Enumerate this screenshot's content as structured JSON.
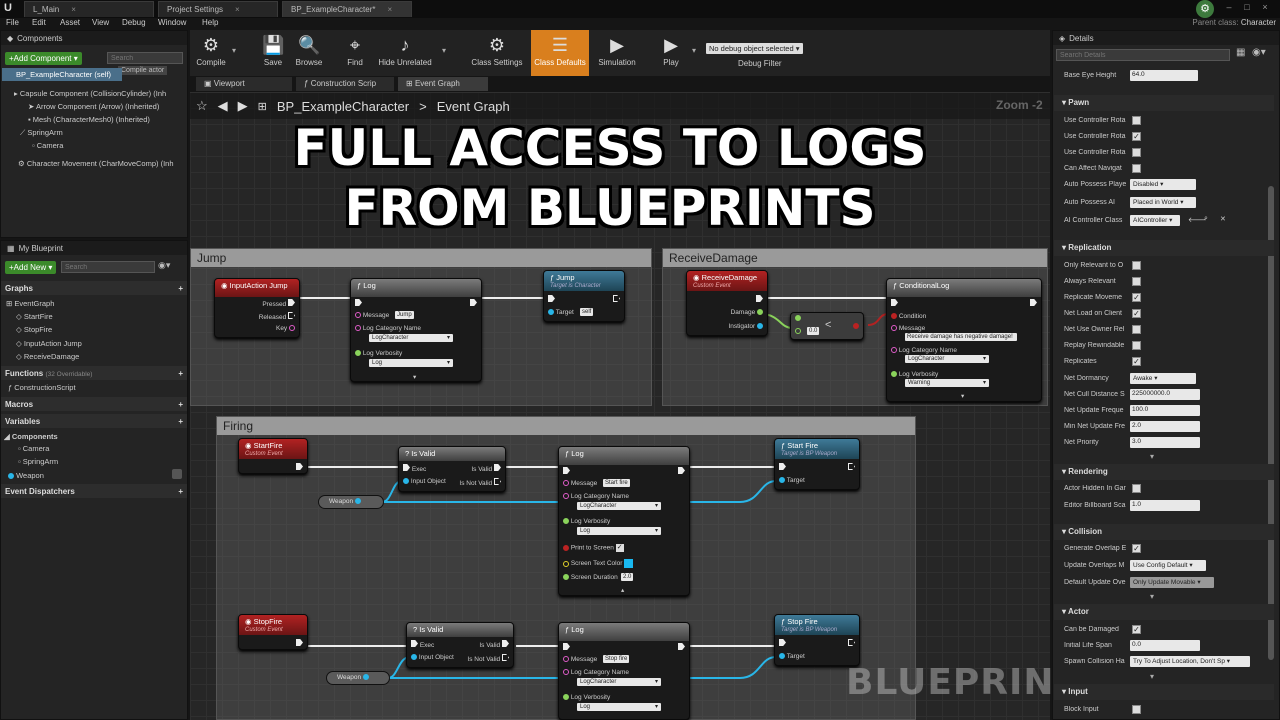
{
  "titlebar": {
    "tabs": [
      "L_Main",
      "Project Settings",
      "BP_ExampleCharacter*"
    ],
    "parent_class_label": "Parent class:",
    "parent_class_value": "Character"
  },
  "menu": [
    "File",
    "Edit",
    "Asset",
    "View",
    "Debug",
    "Window",
    "Help"
  ],
  "components": {
    "title": "Components",
    "add_button": "+Add Component ▾",
    "search_placeholder": "Search",
    "tooltip": "Compile actor",
    "items": [
      "BP_ExampleCharacter (self)",
      "Capsule Component (CollisionCylinder) (Inh",
      "Arrow Component (Arrow) (Inherited)",
      "Mesh (CharacterMesh0) (Inherited)",
      "SpringArm",
      "Camera",
      "Character Movement (CharMoveComp) (Inh"
    ]
  },
  "my_blueprint": {
    "title": "My Blueprint",
    "add_button": "+Add New ▾",
    "search_placeholder": "Search",
    "graphs_label": "Graphs",
    "graph_items": [
      "EventGraph",
      "StartFire",
      "StopFire",
      "InputAction Jump",
      "ReceiveDamage"
    ],
    "functions_label": "Functions",
    "functions_count": "(32 Overridable)",
    "function_items": [
      "ConstructionScript"
    ],
    "macros_label": "Macros",
    "variables_label": "Variables",
    "components_label": "Components",
    "component_vars": [
      "Camera",
      "SpringArm"
    ],
    "weapon_var": "Weapon",
    "dispatchers_label": "Event Dispatchers"
  },
  "toolbar": {
    "compile": "Compile",
    "save": "Save",
    "browse": "Browse",
    "find": "Find",
    "hide_unrelated": "Hide Unrelated",
    "class_settings": "Class Settings",
    "class_defaults": "Class Defaults",
    "simulation": "Simulation",
    "play": "Play",
    "debug_object": "No debug object selected ▾",
    "debug_filter": "Debug Filter"
  },
  "graph_tabs": [
    "Viewport",
    "Construction Scrip",
    "Event Graph"
  ],
  "breadcrumb": {
    "class": "BP_ExampleCharacter",
    "sep": ">",
    "graph": "Event Graph"
  },
  "zoom": "Zoom -2",
  "overlay": {
    "line1": "FULL ACCESS TO LOGS",
    "line2": "FROM BLUEPRINTS"
  },
  "watermark": "BLUEPRINT",
  "graph": {
    "comments": {
      "jump": "Jump",
      "damage": "ReceiveDamage",
      "firing": "Firing"
    },
    "jump_event": {
      "title": "InputAction Jump",
      "pins": [
        "Pressed",
        "Released",
        "Key"
      ]
    },
    "log1": {
      "title": "Log",
      "message_label": "Message",
      "message": "Jump",
      "category_label": "Log Category Name",
      "category": "LogCharacter",
      "verbosity_label": "Log Verbosity",
      "verbosity": "Log"
    },
    "jump_fn": {
      "title": "Jump",
      "sub": "Target is Character",
      "target_label": "Target",
      "target": "self"
    },
    "damage_event": {
      "title": "ReceiveDamage",
      "sub": "Custom Event",
      "pins": [
        "Damage",
        "Instigator"
      ]
    },
    "compare": {
      "value": "0.0",
      "op": "<"
    },
    "cond_log": {
      "title": "ConditionalLog",
      "condition": "Condition",
      "message_label": "Message",
      "message": "Receive damage has negative damage!",
      "category_label": "Log Category Name",
      "category": "LogCharacter",
      "verbosity_label": "Log Verbosity",
      "verbosity": "Warning"
    },
    "start_event": {
      "title": "StartFire",
      "sub": "Custom Event"
    },
    "isvalid1": {
      "title": "Is Valid",
      "exec": "Exec",
      "is_valid": "Is Valid",
      "input": "Input Object",
      "not_valid": "Is Not Valid"
    },
    "weapon": "Weapon",
    "log2": {
      "title": "Log",
      "message_label": "Message",
      "message": "Start fire",
      "category_label": "Log Category Name",
      "category": "LogCharacter",
      "verbosity_label": "Log Verbosity",
      "verbosity": "Log",
      "print_label": "Print to Screen",
      "color_label": "Screen Text Color",
      "duration_label": "Screen Duration",
      "duration": "2.0"
    },
    "startfire_fn": {
      "title": "Start Fire",
      "sub": "Target is BP Weapon",
      "target_label": "Target"
    },
    "stop_event": {
      "title": "StopFire",
      "sub": "Custom Event"
    },
    "isvalid2": {
      "title": "Is Valid",
      "exec": "Exec",
      "is_valid": "Is Valid",
      "input": "Input Object",
      "not_valid": "Is Not Valid"
    },
    "log3": {
      "title": "Log",
      "message_label": "Message",
      "message": "Stop fire",
      "category_label": "Log Category Name",
      "category": "LogCharacter",
      "verbosity_label": "Log Verbosity",
      "verbosity": "Log"
    },
    "stopfire_fn": {
      "title": "Stop Fire",
      "sub": "Target is BP Weapon",
      "target_label": "Target"
    }
  },
  "details": {
    "title": "Details",
    "search_placeholder": "Search Details",
    "base_eye_label": "Base Eye Height",
    "base_eye_value": "64.0",
    "pawn": "Pawn",
    "pawn_rows": [
      {
        "label": "Use Controller Rota",
        "checked": false
      },
      {
        "label": "Use Controller Rota",
        "checked": true
      },
      {
        "label": "Use Controller Rota",
        "checked": false
      },
      {
        "label": "Can Affect Navigat",
        "checked": false
      }
    ],
    "auto_possess_player_label": "Auto Possess Playe",
    "auto_possess_player": "Disabled",
    "auto_possess_ai_label": "Auto Possess AI",
    "auto_possess_ai": "Placed in World",
    "ai_class_label": "AI Controller Class",
    "ai_class": "AIController",
    "replication": "Replication",
    "rep_rows": [
      {
        "label": "Only Relevant to O",
        "checked": false
      },
      {
        "label": "Always Relevant",
        "checked": false
      },
      {
        "label": "Replicate Moveme",
        "checked": true
      },
      {
        "label": "Net Load on Client",
        "checked": true
      },
      {
        "label": "Net Use Owner Rel",
        "checked": false
      },
      {
        "label": "Replay Rewindable",
        "checked": false
      },
      {
        "label": "Replicates",
        "checked": true
      }
    ],
    "net_dormancy_label": "Net Dormancy",
    "net_dormancy": "Awake",
    "net_cull_label": "Net Cull Distance S",
    "net_cull": "225000000.0",
    "net_update_label": "Net Update Freque",
    "net_update": "100.0",
    "min_net_label": "Min Net Update Fre",
    "min_net": "2.0",
    "net_priority_label": "Net Priority",
    "net_priority": "3.0",
    "rendering": "Rendering",
    "actor_hidden_label": "Actor Hidden In Gar",
    "billboard_label": "Editor Billboard Sca",
    "billboard": "1.0",
    "collision": "Collision",
    "gen_overlap_label": "Generate Overlap E",
    "update_overlaps_label": "Update Overlaps M",
    "update_overlaps": "Use Config Default",
    "default_update_label": "Default Update Ove",
    "default_update": "Only Update Movable",
    "actor": "Actor",
    "can_damaged_label": "Can be Damaged",
    "life_span_label": "Initial Life Span",
    "life_span": "0.0",
    "spawn_label": "Spawn Collision Ha",
    "spawn": "Try To Adjust Location, Don't Sp",
    "input": "Input",
    "block_input_label": "Block Input"
  }
}
